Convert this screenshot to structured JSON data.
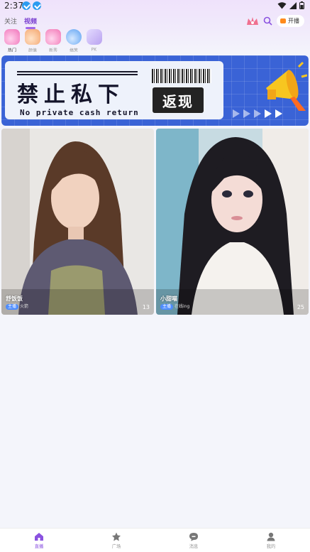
{
  "status_bar": {
    "time": "2:37"
  },
  "header": {
    "tabs": [
      {
        "label": "关注",
        "active": false
      },
      {
        "label": "视频",
        "active": true
      }
    ],
    "live_button": "开播"
  },
  "categories": [
    {
      "label": "热门",
      "icon": "flame-icon",
      "color": "#f070b8",
      "active": true
    },
    {
      "label": "颜值",
      "icon": "gem-icon",
      "color": "#f3a36b",
      "active": false
    },
    {
      "label": "新秀",
      "icon": "star-icon",
      "color": "#f274b4",
      "active": false
    },
    {
      "label": "搞笑",
      "icon": "smile-icon",
      "color": "#5aa0f2",
      "active": false
    },
    {
      "label": "PK",
      "icon": "pk-icon",
      "color": "#b9a2f0",
      "active": false
    }
  ],
  "banner": {
    "title": "禁止私下",
    "subtitle": "No private  cash return",
    "badge": "返现"
  },
  "feed": [
    {
      "name": "舒饭饭",
      "tag": "主播",
      "distance": "火箭",
      "count": "13"
    },
    {
      "name": "小甜喵",
      "tag": "主播",
      "distance": "在线ing",
      "count": "25"
    }
  ],
  "bottom_nav": [
    {
      "label": "直播",
      "icon": "home-icon",
      "active": true
    },
    {
      "label": "广场",
      "icon": "planet-icon",
      "active": false
    },
    {
      "label": "消息",
      "icon": "message-icon",
      "active": false
    },
    {
      "label": "我的",
      "icon": "user-icon",
      "active": false
    }
  ],
  "colors": {
    "accent": "#8a52e0",
    "banner_blue": "#3a63d6"
  }
}
